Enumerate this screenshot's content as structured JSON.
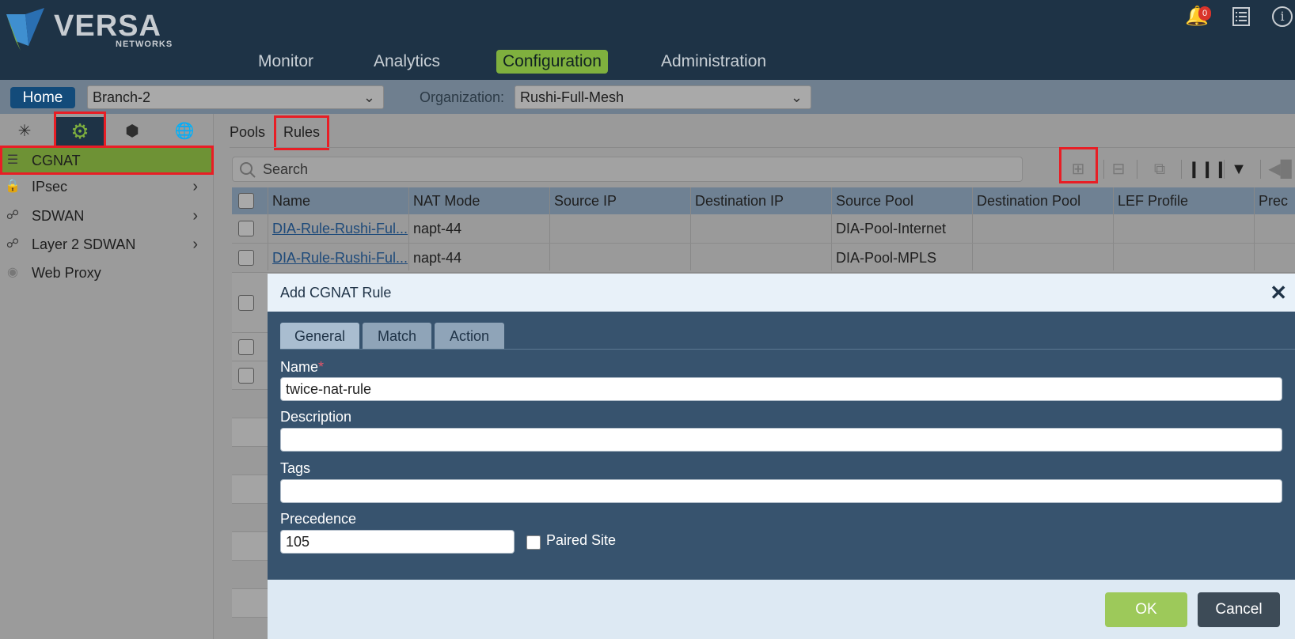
{
  "brand": {
    "name": "VERSA",
    "sub": "NETWORKS"
  },
  "header": {
    "notifications_count": "0",
    "nav": [
      "Monitor",
      "Analytics",
      "Configuration",
      "Administration"
    ]
  },
  "subbar": {
    "home_label": "Home",
    "device": "Branch-2",
    "org_label": "Organization:",
    "org_value": "Rushi-Full-Mesh"
  },
  "sidebar": {
    "items": [
      {
        "label": "CGNAT"
      },
      {
        "label": "IPsec"
      },
      {
        "label": "SDWAN"
      },
      {
        "label": "Layer 2 SDWAN"
      },
      {
        "label": "Web Proxy"
      }
    ]
  },
  "main": {
    "tabs": [
      "Pools",
      "Rules"
    ],
    "search_placeholder": "Search"
  },
  "table": {
    "columns": [
      "Name",
      "NAT Mode",
      "Source IP",
      "Destination IP",
      "Source Pool",
      "Destination Pool",
      "LEF Profile",
      "Prec"
    ],
    "rows": [
      {
        "name": "DIA-Rule-Rushi-Ful...",
        "nat_mode": "napt-44",
        "source_pool": "DIA-Pool-Internet"
      },
      {
        "name": "DIA-Rule-Rushi-Ful...",
        "nat_mode": "napt-44",
        "source_pool": "DIA-Pool-MPLS"
      }
    ]
  },
  "modal": {
    "title": "Add CGNAT Rule",
    "tabs": [
      "General",
      "Match",
      "Action"
    ],
    "name_label": "Name",
    "name_required": "*",
    "name_value": "twice-nat-rule",
    "description_label": "Description",
    "description_value": "",
    "tags_label": "Tags",
    "tags_value": "",
    "precedence_label": "Precedence",
    "precedence_value": "105",
    "paired_site_label": "Paired Site",
    "ok_label": "OK",
    "cancel_label": "Cancel"
  },
  "colors": {
    "header_bg": "#1e3346",
    "accent": "#7fb03e",
    "highlight_box": "#e81e25",
    "modal_bg": "#37536e"
  }
}
